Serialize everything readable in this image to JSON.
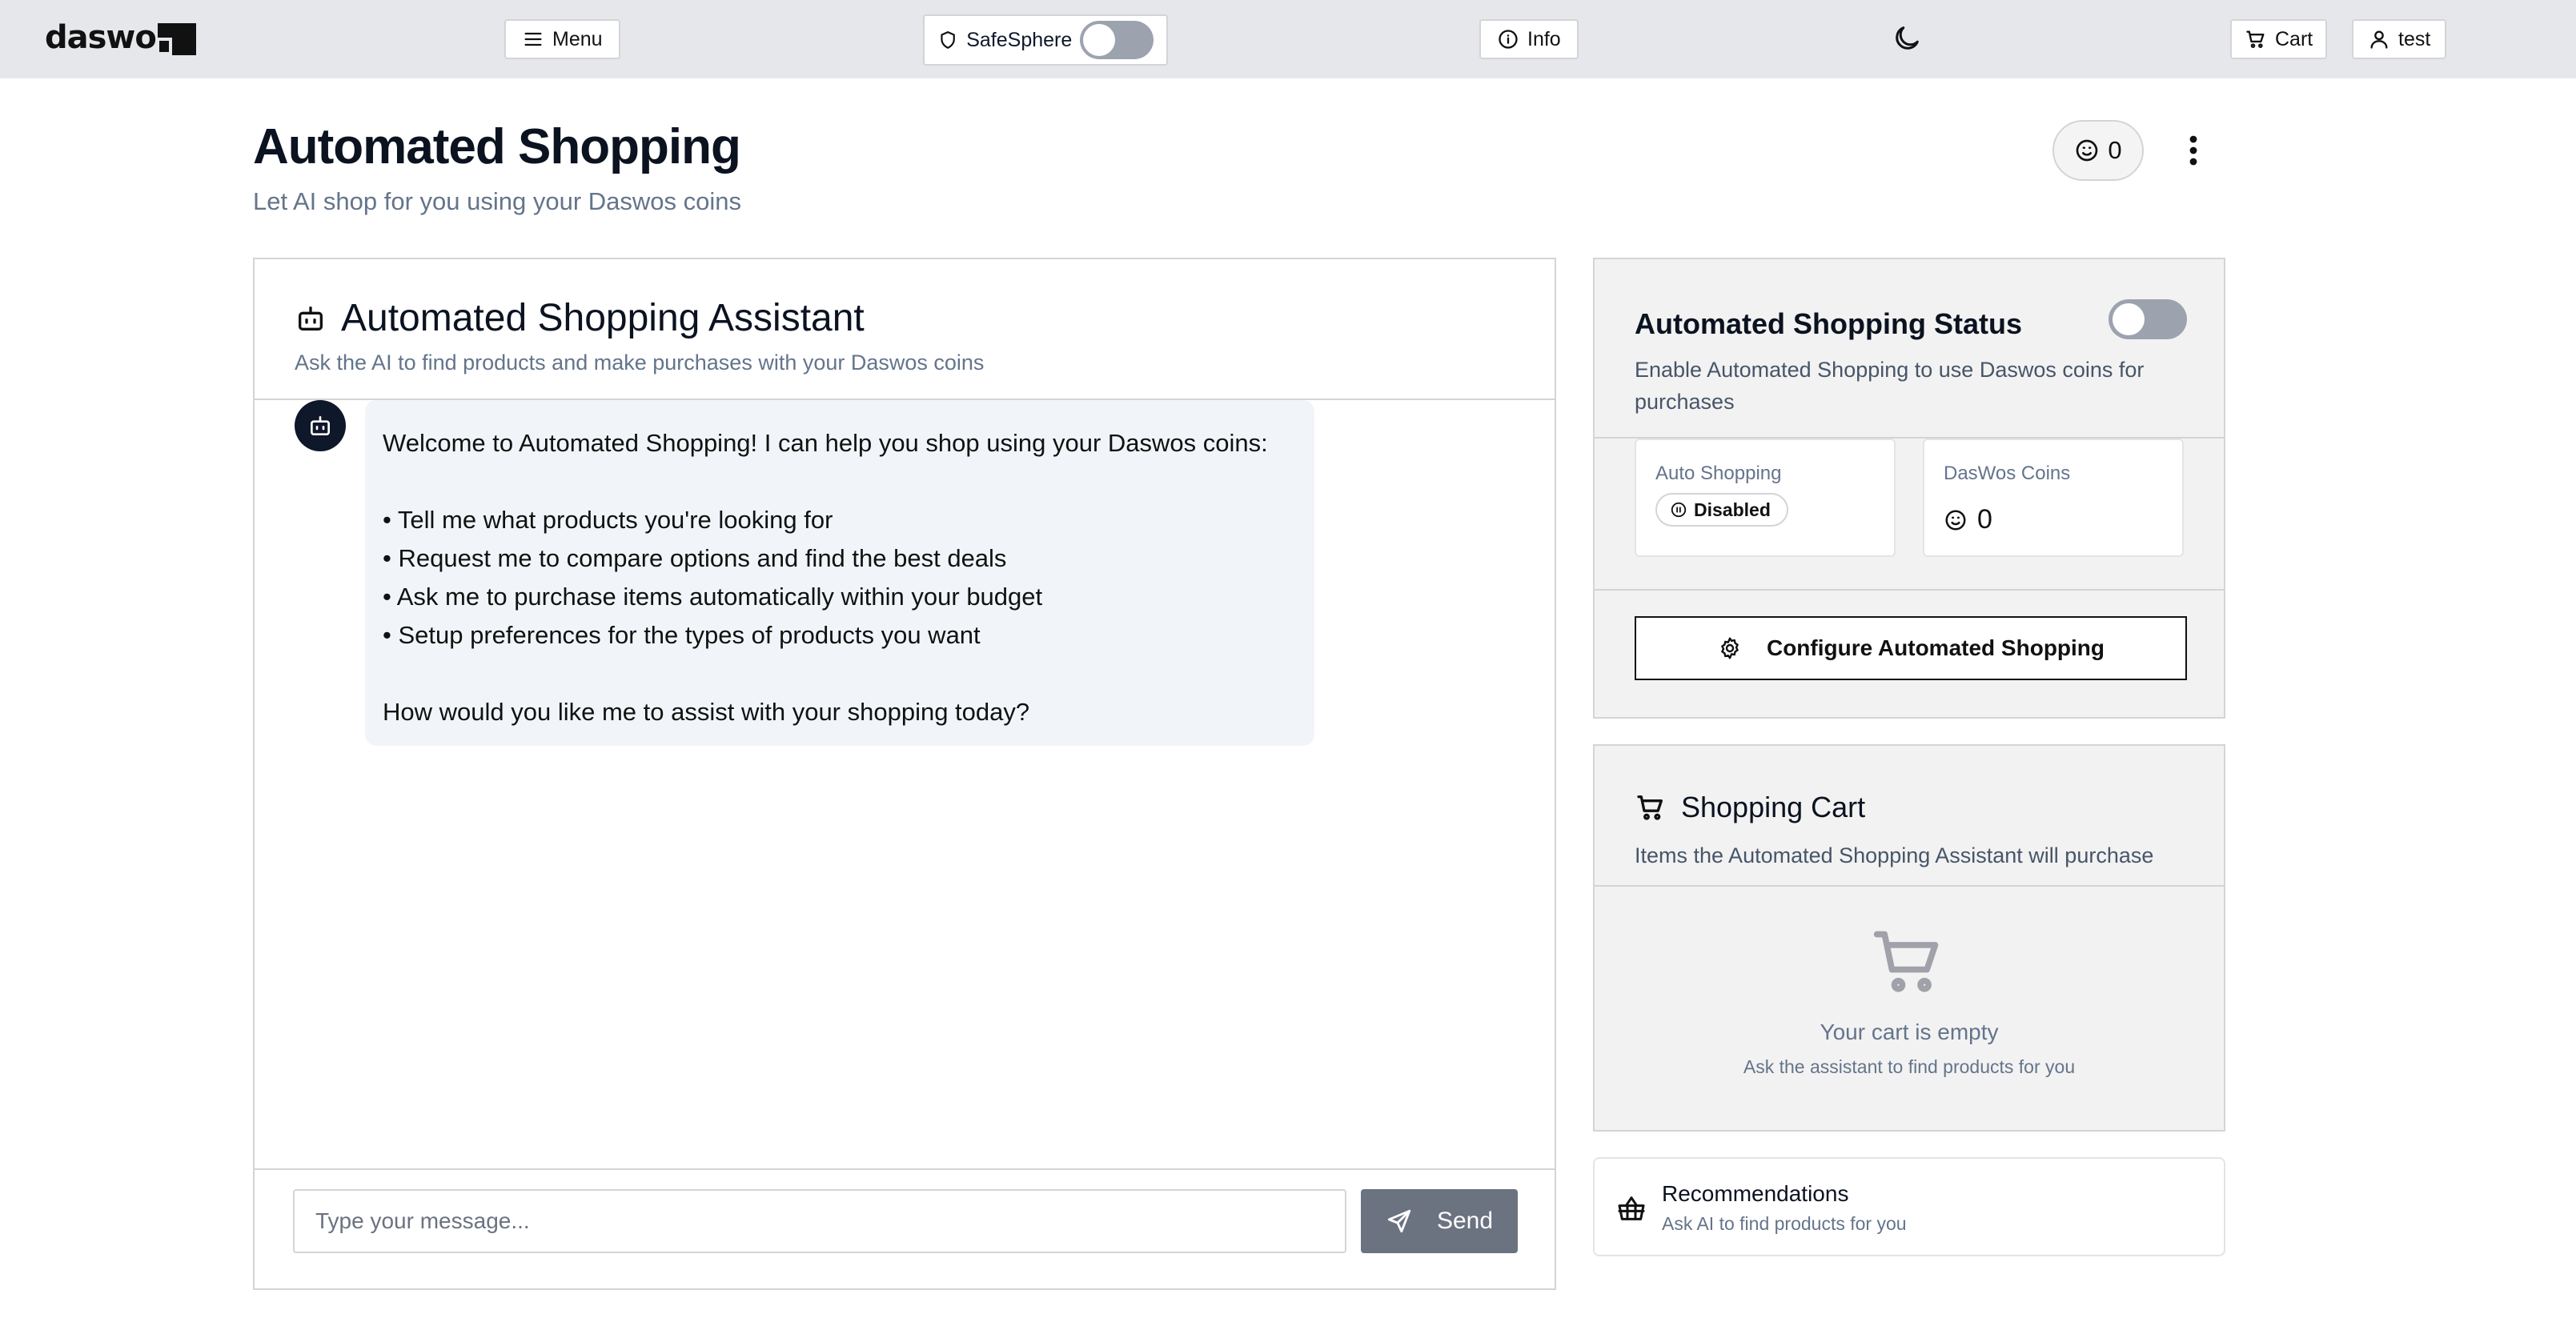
{
  "topbar": {
    "logo_text": "daswo",
    "menu_label": "Menu",
    "safesphere_label": "SafeSphere",
    "safesphere_enabled": false,
    "info_label": "Info",
    "theme_icon": "moon-icon",
    "cart_label": "Cart",
    "user_label": "test"
  },
  "page": {
    "title": "Automated Shopping",
    "subtitle": "Let AI shop for you using your Daswos coins",
    "coin_balance": "0"
  },
  "chat": {
    "title": "Automated Shopping Assistant",
    "description": "Ask the AI to find products and make purchases with your Daswos coins",
    "welcome": {
      "intro": "Welcome to Automated Shopping! I can help you shop using your Daswos coins:",
      "bullets": [
        "• Tell me what products you're looking for",
        "• Request me to compare options and find the best deals",
        "• Ask me to purchase items automatically within your budget",
        "• Setup preferences for the types of products you want"
      ],
      "outro": "How would you like me to assist with your shopping today?"
    },
    "input_placeholder": "Type your message...",
    "input_value": "",
    "send_label": "Send"
  },
  "status": {
    "title": "Automated Shopping Status",
    "enabled": false,
    "description": "Enable Automated Shopping to use Daswos coins for purchases",
    "auto_label": "Auto Shopping",
    "auto_value": "Disabled",
    "coins_label": "DasWos Coins",
    "coins_value": "0",
    "configure_label": "Configure Automated Shopping"
  },
  "cart": {
    "title": "Shopping Cart",
    "description": "Items the Automated Shopping Assistant will purchase",
    "empty_title": "Your cart is empty",
    "empty_sub": "Ask the assistant to find products for you"
  },
  "recommendations": {
    "title": "Recommendations",
    "subtitle": "Ask AI to find products for you"
  },
  "colors": {
    "topbar_bg": "#e5e7eb",
    "toggle_off": "#9ca3af",
    "send_button": "#6b7280",
    "bubble_bg": "#f1f5f9",
    "panel_bg": "#f2f2f2"
  }
}
